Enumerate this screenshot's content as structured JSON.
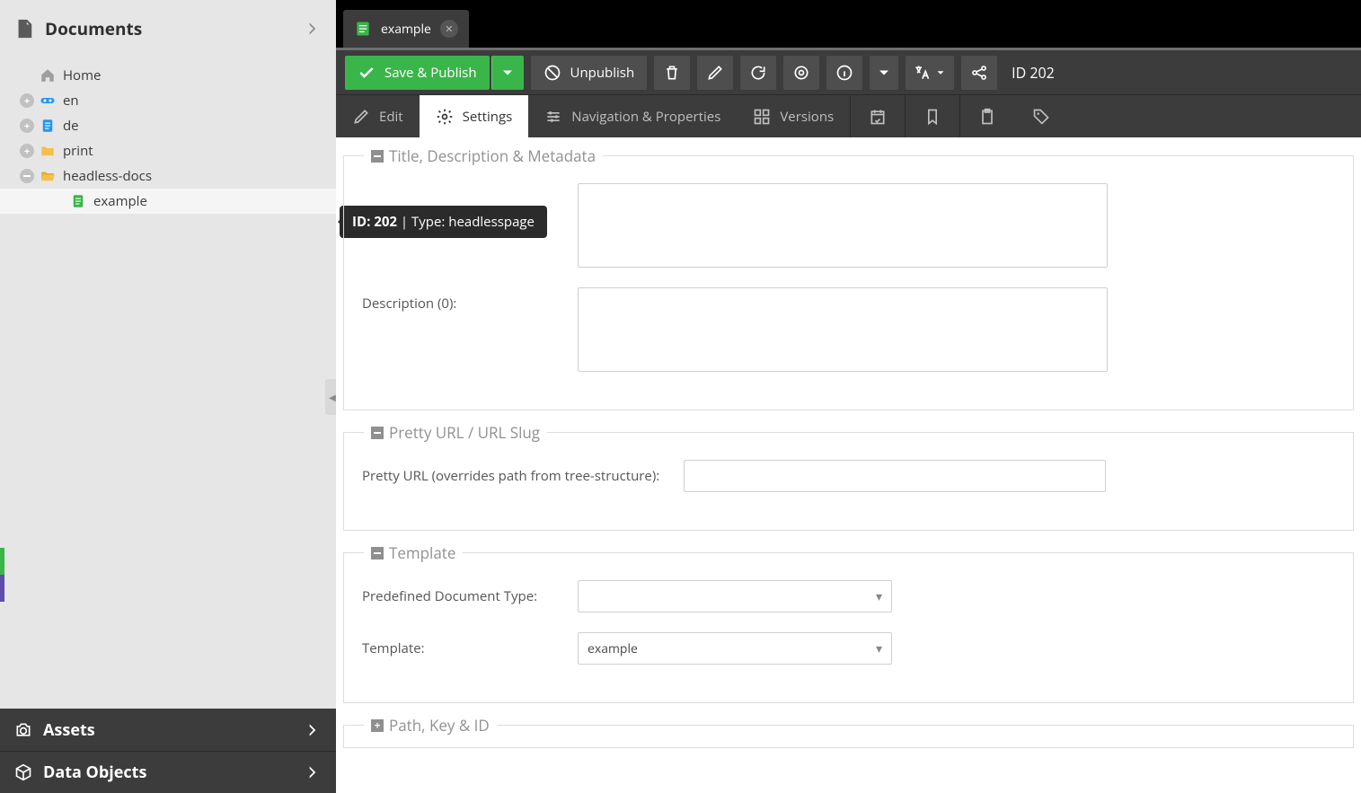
{
  "sidebar": {
    "panels": {
      "documents": "Documents",
      "assets": "Assets",
      "dataobjects": "Data Objects"
    },
    "tree": [
      {
        "label": "Home",
        "icon": "home",
        "expander": "none",
        "indent": 1
      },
      {
        "label": "en",
        "icon": "link",
        "expander": "plus",
        "indent": 1
      },
      {
        "label": "de",
        "icon": "doc-blue",
        "expander": "plus",
        "indent": 1
      },
      {
        "label": "print",
        "icon": "folder",
        "expander": "plus",
        "indent": 1
      },
      {
        "label": "headless-docs",
        "icon": "folder-open",
        "expander": "minus",
        "indent": 1
      },
      {
        "label": "example",
        "icon": "doc-green",
        "expander": "none",
        "indent": 2,
        "selected": true
      }
    ]
  },
  "tab": {
    "label": "example"
  },
  "toolbar": {
    "save_publish": "Save & Publish",
    "unpublish": "Unpublish",
    "id_label": "ID 202"
  },
  "subtabs": {
    "edit": "Edit",
    "settings": "Settings",
    "navprops": "Navigation & Properties",
    "versions": "Versions"
  },
  "tooltip": {
    "id": "ID: 202",
    "type": "Type: headlesspage"
  },
  "form": {
    "section_title": "Title, Description & Metadata",
    "description_label": "Description (0):",
    "section_url": "Pretty URL / URL Slug",
    "pretty_url_label": "Pretty URL (overrides path from tree-structure):",
    "section_template": "Template",
    "predef_label": "Predefined Document Type:",
    "template_label": "Template:",
    "template_value": "example",
    "predef_value": "",
    "section_path": "Path, Key & ID"
  }
}
